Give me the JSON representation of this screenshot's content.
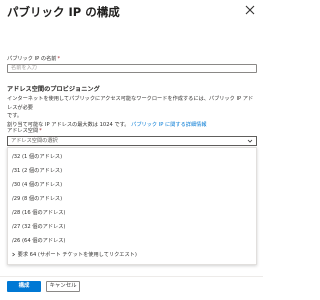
{
  "panel": {
    "title": "パブリック IP の構成"
  },
  "form": {
    "name_label": "パブリック IP の名前",
    "required_mark": "*",
    "name_placeholder": "名前を入力",
    "section_title": "アドレス空間のプロビジョニング",
    "description_line1": "インターネットを使用してパブリックにアクセス可能なワークロードを作成するには、パブリック IP アドレスが必要",
    "description_line2": "です。",
    "description_line3": "割り当て可能な IP アドレスの最大数は 1024 です。",
    "description_link": "パブリック IP に関する詳細情報",
    "address_label": "アドレス空間",
    "address_placeholder": "アドレス空間の選択",
    "options": [
      "/32 (1 個のアドレス)",
      "/31 (2 個のアドレス)",
      "/30 (4 個のアドレス)",
      "/29 (8 個のアドレス)",
      "/28 (16 個のアドレス)",
      "/27 (32 個のアドレス)",
      "/26 (64 個のアドレス)"
    ],
    "custom_option": "要求 64 (サポート チケットを使用してリクエスト)"
  },
  "footer": {
    "primary_label": "構成",
    "secondary_label": "キャンセル"
  },
  "colors": {
    "accent": "#0078d4",
    "required": "#a4262c",
    "text": "#323130"
  }
}
